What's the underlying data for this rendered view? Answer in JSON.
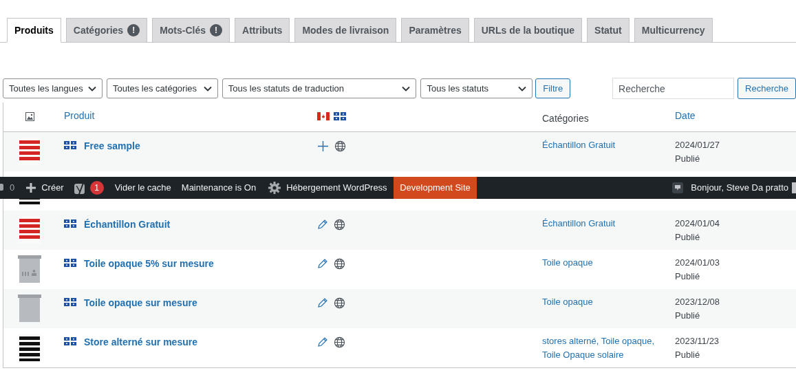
{
  "tabs": [
    {
      "label": "Produits",
      "selected": true
    },
    {
      "label": "Catégories",
      "selected": false,
      "badge": "!"
    },
    {
      "label": "Mots-Clés",
      "selected": false,
      "badge": "!"
    },
    {
      "label": "Attributs",
      "selected": false
    },
    {
      "label": "Modes de livraison",
      "selected": false
    },
    {
      "label": "Paramètres",
      "selected": false
    },
    {
      "label": "URLs de la boutique",
      "selected": false
    },
    {
      "label": "Statut",
      "selected": false
    },
    {
      "label": "Multicurrency",
      "selected": false
    }
  ],
  "filters": [
    {
      "value": "Toutes les langues"
    },
    {
      "value": "Toutes les catégories"
    },
    {
      "value": "Tous les statuts de traduction"
    },
    {
      "value": "Tous les statuts"
    }
  ],
  "filter_button": "Filtre",
  "search": {
    "placeholder": "Recherche",
    "button": "Recherche"
  },
  "table": {
    "columns": {
      "product": "Produit",
      "categories": "Catégories",
      "date": "Date"
    },
    "rows": [
      {
        "thumbnail": {
          "kind": "red_stripes"
        },
        "name": "Free sample",
        "translation": {
          "kind": "add"
        },
        "categories": "Échantillon Gratuit",
        "date": "2024/01/27",
        "status": "Publié"
      },
      {
        "thumbnail": {
          "kind": "black_stripes"
        }
      },
      {
        "thumbnail": {
          "kind": "red_stripes"
        },
        "name": "Échantillon Gratuit",
        "translation": {
          "kind": "edit"
        },
        "categories": "Échantillon Gratuit",
        "date": "2024/01/04",
        "status": "Publié"
      },
      {
        "thumbnail": {
          "kind": "gray_print"
        },
        "name": "Toile opaque 5% sur mesure",
        "translation": {
          "kind": "edit"
        },
        "categories": "Toile opaque",
        "date": "2024/01/03",
        "status": "Publié"
      },
      {
        "thumbnail": {
          "kind": "gray"
        },
        "name": "Toile opaque sur mesure",
        "translation": {
          "kind": "edit"
        },
        "categories": "Toile opaque",
        "date": "2023/12/08",
        "status": "Publié"
      },
      {
        "thumbnail": {
          "kind": "black_stripes"
        },
        "name": "Store alterné sur mesure",
        "translation": {
          "kind": "edit"
        },
        "categories": "stores alterné, Toile opaque, Toile Opaque solaire",
        "date": "2023/11/23",
        "status": "Publié"
      }
    ]
  },
  "admin_bar": {
    "comments": "0",
    "new": "Créer",
    "seo_badge": "1",
    "items": [
      "Vider le cache",
      "Maintenance is On"
    ],
    "hosting": "Hébergement WordPress",
    "environment": "Development Site",
    "greeting": "Bonjour, Steve Da pratto"
  }
}
